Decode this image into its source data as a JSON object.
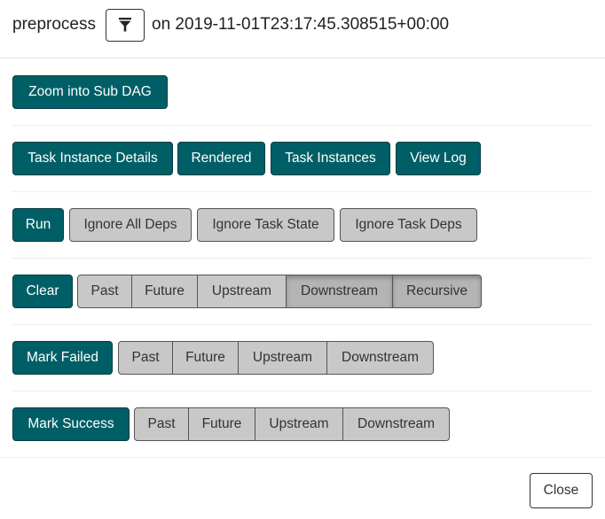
{
  "header": {
    "task_id": "preprocess",
    "filter_icon": "filter-icon",
    "execution_date_text": "on 2019-11-01T23:17:45.308515+00:00"
  },
  "subdag": {
    "zoom_label": "Zoom into Sub DAG"
  },
  "links": {
    "task_instance_details": "Task Instance Details",
    "rendered": "Rendered",
    "task_instances": "Task Instances",
    "view_log": "View Log"
  },
  "run": {
    "run_label": "Run",
    "ignore_all_deps": "Ignore All Deps",
    "ignore_task_state": "Ignore Task State",
    "ignore_task_deps": "Ignore Task Deps"
  },
  "clear": {
    "label": "Clear",
    "options": {
      "past": "Past",
      "future": "Future",
      "upstream": "Upstream",
      "downstream": "Downstream",
      "recursive": "Recursive"
    },
    "active_options": [
      "Downstream",
      "Recursive"
    ]
  },
  "mark_failed": {
    "label": "Mark Failed",
    "options": {
      "past": "Past",
      "future": "Future",
      "upstream": "Upstream",
      "downstream": "Downstream"
    }
  },
  "mark_success": {
    "label": "Mark Success",
    "options": {
      "past": "Past",
      "future": "Future",
      "upstream": "Upstream",
      "downstream": "Downstream"
    }
  },
  "footer": {
    "close_label": "Close"
  },
  "colors": {
    "primary": "#005f66",
    "option_gray": "#c8c8c8",
    "option_active": "#b4b4b4"
  }
}
